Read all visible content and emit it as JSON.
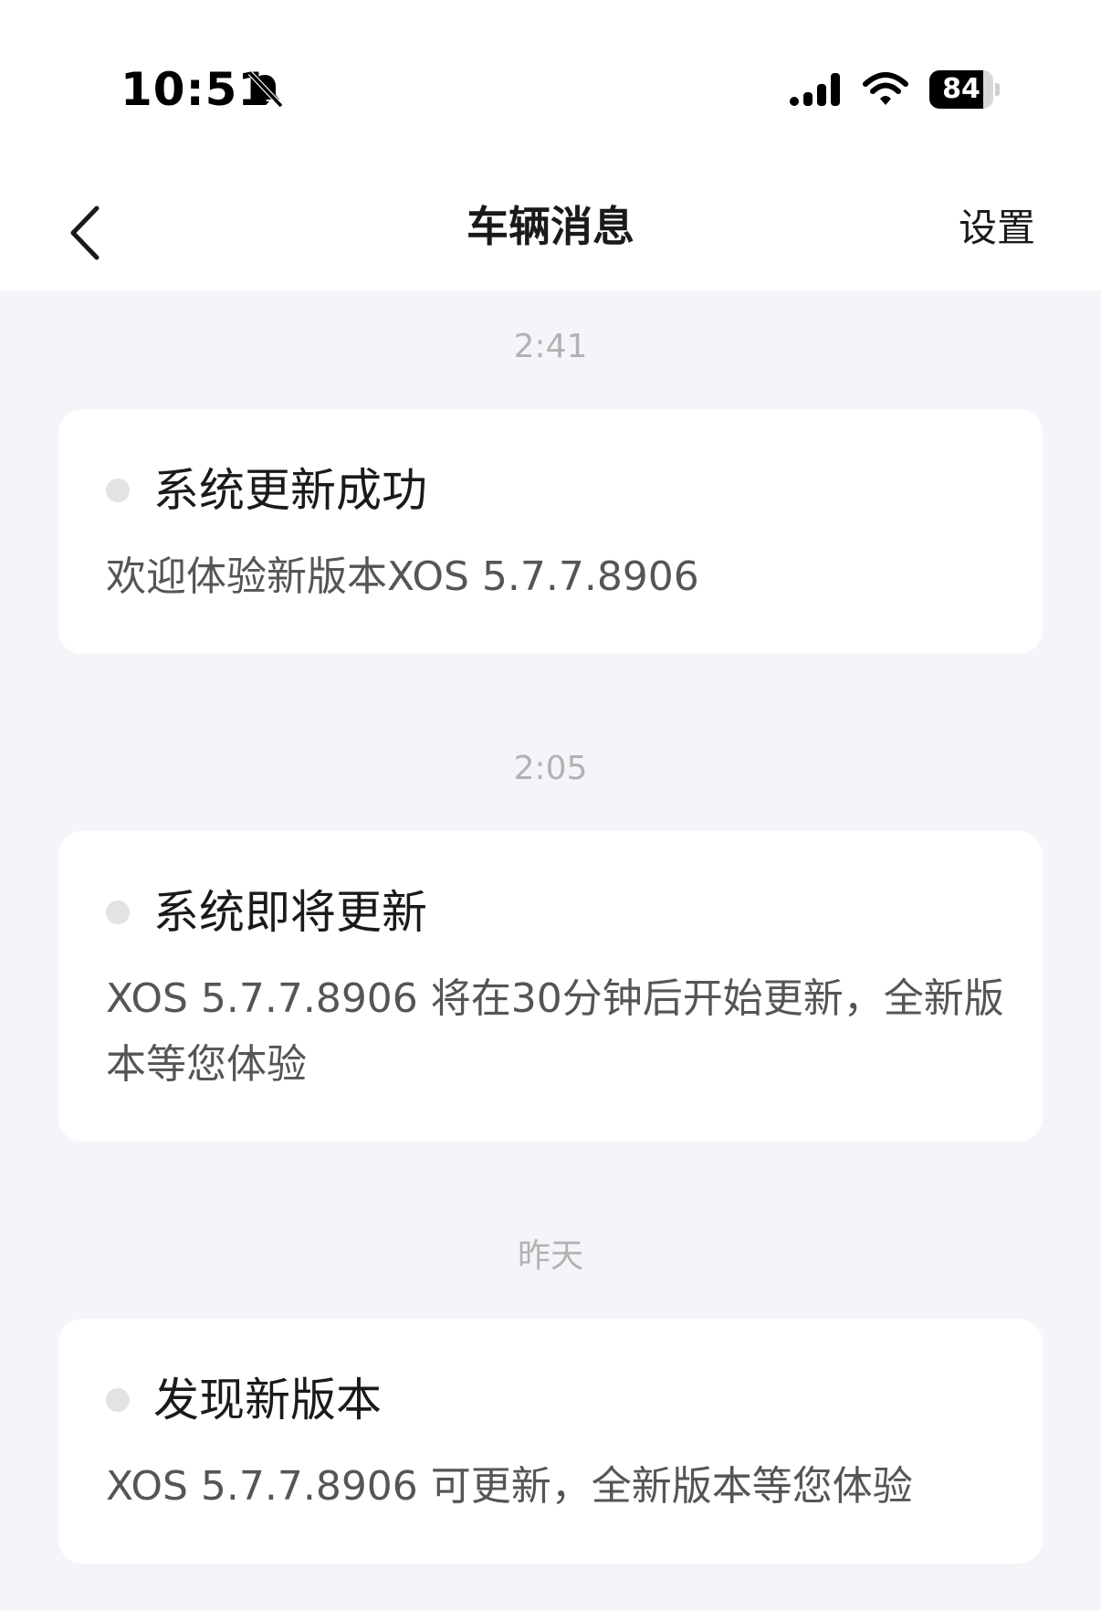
{
  "status_bar": {
    "time": "10:51",
    "battery_percent": 84,
    "battery_label": "84"
  },
  "nav": {
    "title": "车辆消息",
    "settings_label": "设置"
  },
  "messages": [
    {
      "time_label": "2:41",
      "title": "系统更新成功",
      "body": "欢迎体验新版本XOS 5.7.7.8906"
    },
    {
      "time_label": "2:05",
      "title": "系统即将更新",
      "body": "XOS 5.7.7.8906 将在30分钟后开始更新，全新版本等您体验"
    },
    {
      "time_label": "昨天",
      "title": "发现新版本",
      "body": "XOS 5.7.7.8906 可更新，全新版本等您体验"
    }
  ],
  "colors": {
    "background": "#f4f5f9",
    "card": "#ffffff",
    "time_label": "#b2b2b2",
    "unread_dot": "#e3e3e3"
  },
  "icons": {
    "back": "chevron-left-icon",
    "mute": "bell-slash-icon",
    "signal": "cellular-signal-icon",
    "wifi": "wifi-icon",
    "battery": "battery-icon"
  }
}
